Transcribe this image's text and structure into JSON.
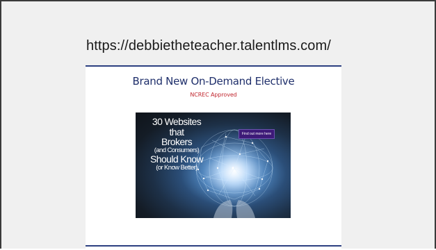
{
  "slide": {
    "url": "https://debbietheteacher.talentlms.com/"
  },
  "panel": {
    "heading": "Brand New On-Demand Elective",
    "subheading": "NCREC Approved"
  },
  "banner": {
    "title_lines": [
      "30 Websites",
      "that",
      "Brokers",
      "(and Consumers)",
      "Should Know",
      "(or Know Better)"
    ],
    "cta_label": "Find out more here"
  },
  "colors": {
    "heading": "#1f2f6b",
    "subheading": "#c0262e",
    "rule": "#2b3f80",
    "cta_background": "#3d1a78"
  },
  "icons": [
    "globe-network-illustration",
    "hands-illustration"
  ]
}
